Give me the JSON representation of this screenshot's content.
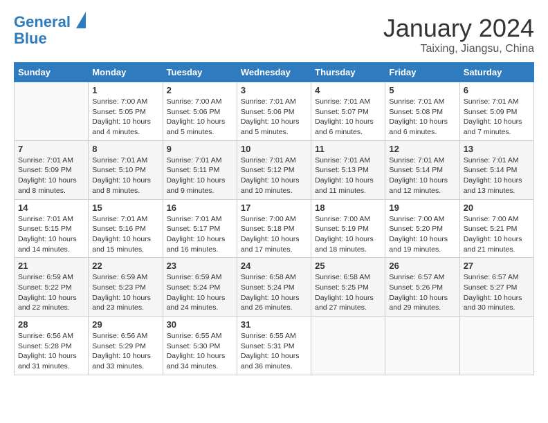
{
  "header": {
    "logo_line1": "General",
    "logo_line2": "Blue",
    "month": "January 2024",
    "location": "Taixing, Jiangsu, China"
  },
  "weekdays": [
    "Sunday",
    "Monday",
    "Tuesday",
    "Wednesday",
    "Thursday",
    "Friday",
    "Saturday"
  ],
  "weeks": [
    [
      {
        "day": "",
        "info": ""
      },
      {
        "day": "1",
        "info": "Sunrise: 7:00 AM\nSunset: 5:05 PM\nDaylight: 10 hours\nand 4 minutes."
      },
      {
        "day": "2",
        "info": "Sunrise: 7:00 AM\nSunset: 5:06 PM\nDaylight: 10 hours\nand 5 minutes."
      },
      {
        "day": "3",
        "info": "Sunrise: 7:01 AM\nSunset: 5:06 PM\nDaylight: 10 hours\nand 5 minutes."
      },
      {
        "day": "4",
        "info": "Sunrise: 7:01 AM\nSunset: 5:07 PM\nDaylight: 10 hours\nand 6 minutes."
      },
      {
        "day": "5",
        "info": "Sunrise: 7:01 AM\nSunset: 5:08 PM\nDaylight: 10 hours\nand 6 minutes."
      },
      {
        "day": "6",
        "info": "Sunrise: 7:01 AM\nSunset: 5:09 PM\nDaylight: 10 hours\nand 7 minutes."
      }
    ],
    [
      {
        "day": "7",
        "info": "Sunrise: 7:01 AM\nSunset: 5:09 PM\nDaylight: 10 hours\nand 8 minutes."
      },
      {
        "day": "8",
        "info": "Sunrise: 7:01 AM\nSunset: 5:10 PM\nDaylight: 10 hours\nand 8 minutes."
      },
      {
        "day": "9",
        "info": "Sunrise: 7:01 AM\nSunset: 5:11 PM\nDaylight: 10 hours\nand 9 minutes."
      },
      {
        "day": "10",
        "info": "Sunrise: 7:01 AM\nSunset: 5:12 PM\nDaylight: 10 hours\nand 10 minutes."
      },
      {
        "day": "11",
        "info": "Sunrise: 7:01 AM\nSunset: 5:13 PM\nDaylight: 10 hours\nand 11 minutes."
      },
      {
        "day": "12",
        "info": "Sunrise: 7:01 AM\nSunset: 5:14 PM\nDaylight: 10 hours\nand 12 minutes."
      },
      {
        "day": "13",
        "info": "Sunrise: 7:01 AM\nSunset: 5:14 PM\nDaylight: 10 hours\nand 13 minutes."
      }
    ],
    [
      {
        "day": "14",
        "info": "Sunrise: 7:01 AM\nSunset: 5:15 PM\nDaylight: 10 hours\nand 14 minutes."
      },
      {
        "day": "15",
        "info": "Sunrise: 7:01 AM\nSunset: 5:16 PM\nDaylight: 10 hours\nand 15 minutes."
      },
      {
        "day": "16",
        "info": "Sunrise: 7:01 AM\nSunset: 5:17 PM\nDaylight: 10 hours\nand 16 minutes."
      },
      {
        "day": "17",
        "info": "Sunrise: 7:00 AM\nSunset: 5:18 PM\nDaylight: 10 hours\nand 17 minutes."
      },
      {
        "day": "18",
        "info": "Sunrise: 7:00 AM\nSunset: 5:19 PM\nDaylight: 10 hours\nand 18 minutes."
      },
      {
        "day": "19",
        "info": "Sunrise: 7:00 AM\nSunset: 5:20 PM\nDaylight: 10 hours\nand 19 minutes."
      },
      {
        "day": "20",
        "info": "Sunrise: 7:00 AM\nSunset: 5:21 PM\nDaylight: 10 hours\nand 21 minutes."
      }
    ],
    [
      {
        "day": "21",
        "info": "Sunrise: 6:59 AM\nSunset: 5:22 PM\nDaylight: 10 hours\nand 22 minutes."
      },
      {
        "day": "22",
        "info": "Sunrise: 6:59 AM\nSunset: 5:23 PM\nDaylight: 10 hours\nand 23 minutes."
      },
      {
        "day": "23",
        "info": "Sunrise: 6:59 AM\nSunset: 5:24 PM\nDaylight: 10 hours\nand 24 minutes."
      },
      {
        "day": "24",
        "info": "Sunrise: 6:58 AM\nSunset: 5:24 PM\nDaylight: 10 hours\nand 26 minutes."
      },
      {
        "day": "25",
        "info": "Sunrise: 6:58 AM\nSunset: 5:25 PM\nDaylight: 10 hours\nand 27 minutes."
      },
      {
        "day": "26",
        "info": "Sunrise: 6:57 AM\nSunset: 5:26 PM\nDaylight: 10 hours\nand 29 minutes."
      },
      {
        "day": "27",
        "info": "Sunrise: 6:57 AM\nSunset: 5:27 PM\nDaylight: 10 hours\nand 30 minutes."
      }
    ],
    [
      {
        "day": "28",
        "info": "Sunrise: 6:56 AM\nSunset: 5:28 PM\nDaylight: 10 hours\nand 31 minutes."
      },
      {
        "day": "29",
        "info": "Sunrise: 6:56 AM\nSunset: 5:29 PM\nDaylight: 10 hours\nand 33 minutes."
      },
      {
        "day": "30",
        "info": "Sunrise: 6:55 AM\nSunset: 5:30 PM\nDaylight: 10 hours\nand 34 minutes."
      },
      {
        "day": "31",
        "info": "Sunrise: 6:55 AM\nSunset: 5:31 PM\nDaylight: 10 hours\nand 36 minutes."
      },
      {
        "day": "",
        "info": ""
      },
      {
        "day": "",
        "info": ""
      },
      {
        "day": "",
        "info": ""
      }
    ]
  ]
}
